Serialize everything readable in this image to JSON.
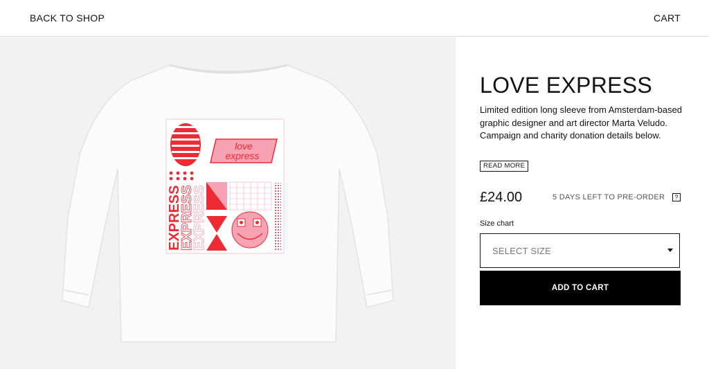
{
  "header": {
    "back_label": "BACK TO SHOP",
    "cart_label": "CART"
  },
  "product": {
    "title": "LOVE EXPRESS",
    "description": "Limited edition long sleeve from Amsterdam-based graphic designer and art director Marta Veludo. Campaign and charity donation details below.",
    "read_more_label": "READ MORE",
    "price": "£24.00",
    "preorder_text": "5 DAYS LEFT TO PRE-ORDER",
    "help_label": "?",
    "size_chart_label": "Size chart",
    "size_select_placeholder": "SELECT SIZE",
    "add_to_cart_label": "ADD TO CART",
    "image": {
      "print_text_top": "love",
      "print_text_bottom": "express",
      "vertical_text": "EXPRESS"
    }
  },
  "colors": {
    "accent_red": "#ee2a35",
    "accent_pink": "#f7a3b3",
    "panel_bg": "#f2f2f2",
    "button_bg": "#000000"
  }
}
